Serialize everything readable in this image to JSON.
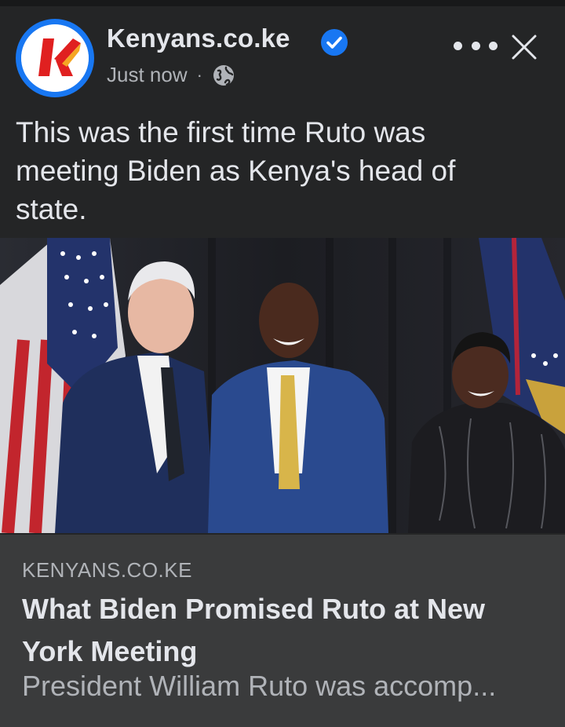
{
  "post": {
    "page_name": "Kenyans.co.ke",
    "timestamp": "Just now",
    "separator": "·",
    "audience_icon": "globe-icon",
    "verified_icon": "verified-badge-icon",
    "more_icon": "more-options-icon",
    "close_icon": "close-icon",
    "text": "This was the first time Ruto was meeting Biden as Kenya's head of state."
  },
  "link_preview": {
    "domain": "KENYANS.CO.KE",
    "title": "What Biden Promised Ruto at New York Meeting",
    "description": "President William Ruto was accomp..."
  },
  "colors": {
    "background": "#242526",
    "preview_background": "#3a3b3c",
    "accent": "#1877f2",
    "primary_text": "#e4e6eb",
    "secondary_text": "#b0b3b8"
  }
}
